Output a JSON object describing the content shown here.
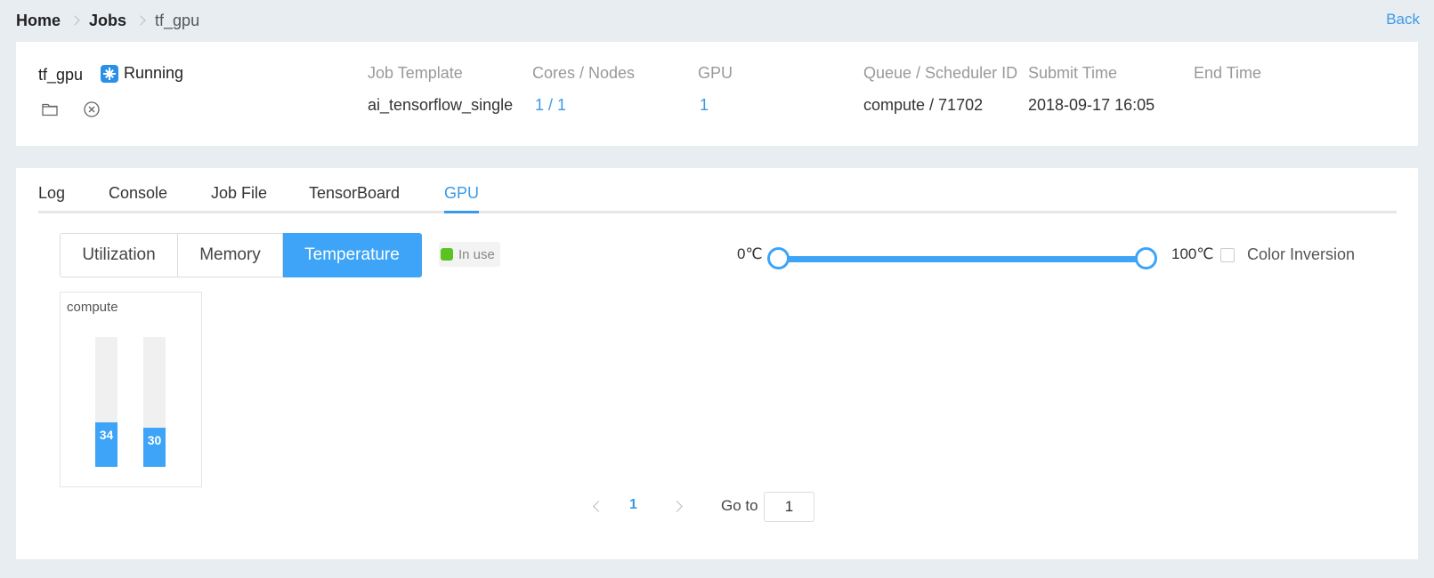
{
  "breadcrumb": {
    "home": "Home",
    "jobs": "Jobs",
    "current": "tf_gpu",
    "back": "Back"
  },
  "job": {
    "name": "tf_gpu",
    "status": "Running",
    "columns": [
      {
        "header": "Job Template",
        "value": "ai_tensorflow_single"
      },
      {
        "header": "Cores / Nodes",
        "value": "1 / 1"
      },
      {
        "header": "GPU",
        "value": "1"
      },
      {
        "header": "Queue / Scheduler ID",
        "value": "compute / 71702"
      },
      {
        "header": "Submit Time",
        "value": "2018-09-17 16:05"
      },
      {
        "header": "End Time",
        "value": ""
      }
    ]
  },
  "tabs": [
    "Log",
    "Console",
    "Job File",
    "TensorBoard",
    "GPU"
  ],
  "active_tab": "GPU",
  "metrics": {
    "options": [
      "Utilization",
      "Memory",
      "Temperature"
    ],
    "selected": "Temperature"
  },
  "legend": {
    "in_use": "In use",
    "in_use_color": "#5cc220"
  },
  "range": {
    "min_label": "0℃",
    "max_label": "100℃",
    "min": 0,
    "max": 100,
    "low": 0,
    "high": 100
  },
  "color_inversion": {
    "label": "Color Inversion",
    "checked": false
  },
  "node": {
    "name": "compute",
    "gpus": [
      {
        "value": 34
      },
      {
        "value": 30
      }
    ]
  },
  "pagination": {
    "current": "1",
    "goto_label": "Go to",
    "goto_value": "1"
  },
  "colors": {
    "accent": "#3a9ae8",
    "bar": "#3da4f7",
    "running": "#2a8fe6"
  }
}
